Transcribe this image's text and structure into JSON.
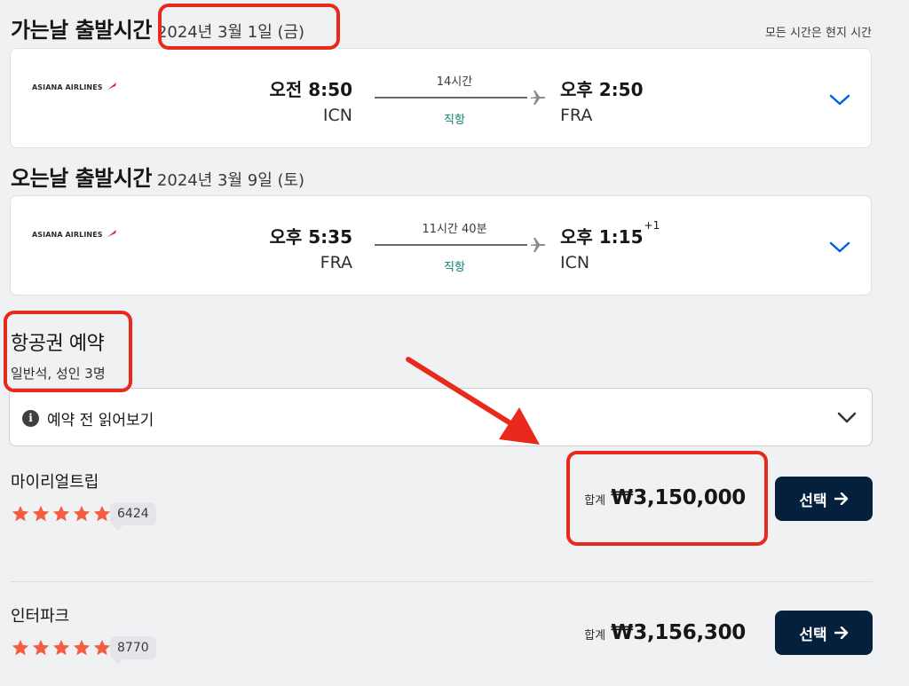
{
  "outbound": {
    "title": "가는날 출발시간",
    "date": "2024년 3월 1일 (금)",
    "note": "모든 시간은 현지 시간",
    "airline": "ASIANA AIRLINES",
    "dep_time": "오전 8:50",
    "dep_code": "ICN",
    "duration": "14시간",
    "stops": "직항",
    "arr_time": "오후 2:50",
    "arr_code": "FRA"
  },
  "inbound": {
    "title": "오는날 출발시간",
    "date": "2024년 3월 9일 (토)",
    "airline": "ASIANA AIRLINES",
    "dep_time": "오후 5:35",
    "dep_code": "FRA",
    "duration": "11시간 40분",
    "stops": "직항",
    "arr_time": "오후 1:15",
    "arr_day_offset": "+1",
    "arr_code": "ICN"
  },
  "booking": {
    "title": "항공권 예약",
    "subtitle": "일반석, 성인 3명",
    "notice": "예약 전 읽어보기"
  },
  "providers": [
    {
      "name": "마이리얼트립",
      "reviews": "6424",
      "rating": 5,
      "total_label": "합계",
      "price": "₩3,150,000",
      "button": "선택"
    },
    {
      "name": "인터파크",
      "reviews": "8770",
      "rating": 5,
      "total_label": "합계",
      "price": "₩3,156,300",
      "button": "선택"
    }
  ],
  "colors": {
    "accent": "#05203c",
    "annotation": "#e8291c",
    "star": "#f55d42",
    "direct": "#0b7f73",
    "chevron": "#0062e3"
  },
  "icons": [
    "asiana-logo-icon",
    "plane-icon",
    "chevron-down-icon",
    "info-icon",
    "star-icon",
    "arrow-right-icon",
    "annotation-arrow"
  ]
}
